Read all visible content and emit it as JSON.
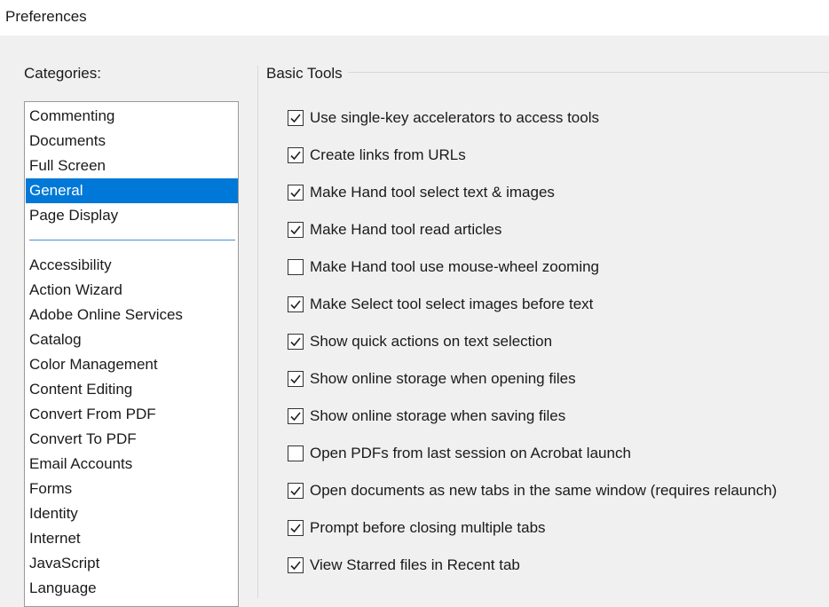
{
  "window": {
    "title": "Preferences"
  },
  "categories": {
    "label": "Categories:",
    "top_items": [
      "Commenting",
      "Documents",
      "Full Screen",
      "General",
      "Page Display"
    ],
    "selected": "General",
    "bottom_items": [
      "Accessibility",
      "Action Wizard",
      "Adobe Online Services",
      "Catalog",
      "Color Management",
      "Content Editing",
      "Convert From PDF",
      "Convert To PDF",
      "Email Accounts",
      "Forms",
      "Identity",
      "Internet",
      "JavaScript",
      "Language"
    ]
  },
  "basic_tools": {
    "label": "Basic Tools",
    "options": [
      {
        "label": "Use single-key accelerators to access tools",
        "checked": true
      },
      {
        "label": "Create links from URLs",
        "checked": true
      },
      {
        "label": "Make Hand tool select text & images",
        "checked": true
      },
      {
        "label": "Make Hand tool read articles",
        "checked": true
      },
      {
        "label": "Make Hand tool use mouse-wheel zooming",
        "checked": false
      },
      {
        "label": "Make Select tool select images before text",
        "checked": true
      },
      {
        "label": "Show quick actions on text selection",
        "checked": true
      },
      {
        "label": "Show online storage when opening files",
        "checked": true
      },
      {
        "label": "Show online storage when saving files",
        "checked": true
      },
      {
        "label": "Open PDFs from last session on Acrobat launch",
        "checked": false
      },
      {
        "label": "Open documents as new tabs in the same window (requires relaunch)",
        "checked": true
      },
      {
        "label": "Prompt before closing multiple tabs",
        "checked": true
      },
      {
        "label": "View Starred files in Recent tab",
        "checked": true
      }
    ]
  },
  "colors": {
    "selection": "#0078d7",
    "separator": "#4a8fd4"
  },
  "icons": {
    "checkbox_checked": "checkmark-icon"
  }
}
